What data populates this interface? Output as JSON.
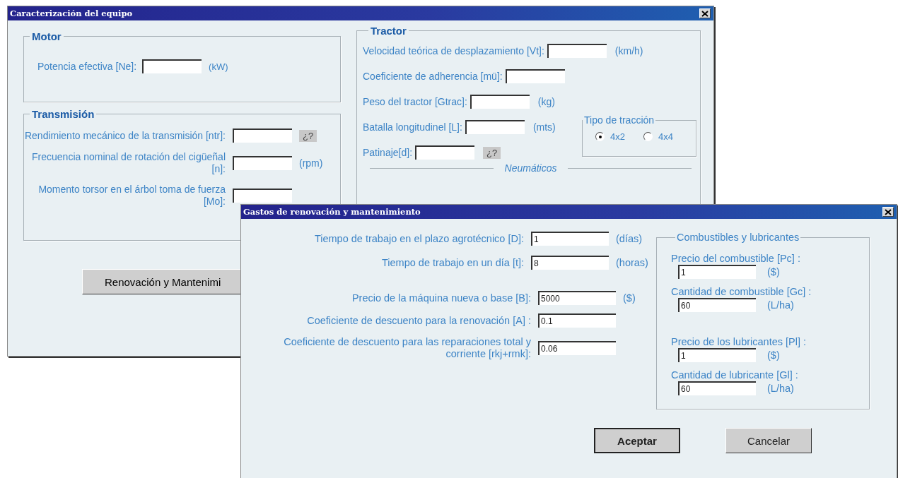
{
  "equipment_window": {
    "title": "Caracterización del equipo",
    "motor_group": {
      "title": "Motor",
      "fields": [
        {
          "label": "Potencia efectiva [Ne]:",
          "unit": "(kW)"
        }
      ]
    },
    "transmission_group": {
      "title": "Transmisión",
      "fields": [
        {
          "label": "Rendimiento mecánico de la transmisión [ntr]:",
          "help_button": "¿?"
        },
        {
          "label": "Frecuencia nominal de rotación del cigüeñal [n]:",
          "unit": "(rpm)"
        },
        {
          "label": "Momento torsor en el árbol toma de fuerza [Mo]:"
        }
      ]
    },
    "tractor_group": {
      "title": "Tractor",
      "fields": [
        {
          "label": "Velocidad teórica de desplazamiento [Vt]:",
          "unit": "(km/h)"
        },
        {
          "label": "Coeficiente de adherencia [mü]:"
        },
        {
          "label": "Peso del tractor [Gtrac]:",
          "unit": "(kg)"
        },
        {
          "label": "Batalla longitudinel [L]:",
          "unit": "(mts)"
        },
        {
          "label": "Patinaje[d]:",
          "help_button": "¿?"
        }
      ],
      "traction_group": {
        "title": "Tipo de tracción",
        "options": [
          {
            "label": "4x2",
            "selected": true
          },
          {
            "label": "4x4",
            "selected": false
          }
        ]
      },
      "tires_heading": "Neumáticos"
    },
    "renewal_button": "Renovación y Mantenimi"
  },
  "costs_window": {
    "title": "Gastos de renovación y mantenimiento",
    "time_fields": [
      {
        "label": "Tiempo de trabajo en el plazo agrotécnico [D]:",
        "value": "1",
        "unit": "(días)"
      },
      {
        "label": "Tiempo de trabajo en un día  [t]:",
        "value": "8",
        "unit": "(horas)"
      }
    ],
    "cost_fields": [
      {
        "label": "Precio de la máquina nueva o base [B]:",
        "value": "5000",
        "unit": "($)"
      },
      {
        "label": "Coeficiente de descuento para la renovación [A] :",
        "value": "0.1"
      },
      {
        "label": "Coeficiente de descuento para las  reparaciones total y corriente [rkj+rmk]:",
        "value": "0.06"
      }
    ],
    "fuel_group": {
      "title": "Combustibles y lubricantes",
      "fields": [
        {
          "label": "Precio del combustible [Pc] :",
          "value": "1",
          "unit": "($)"
        },
        {
          "label": "Cantidad de combustible [Gc] :",
          "value": "60",
          "unit": "(L/ha)"
        },
        {
          "label": "Precio de los lubricantes [Pl] :",
          "value": "1",
          "unit": "($)"
        },
        {
          "label": "Cantidad de lubricante [Gl] :",
          "value": "60",
          "unit": "(L/ha)"
        }
      ]
    },
    "buttons": [
      {
        "label": "Aceptar",
        "default": true
      },
      {
        "label": "Cancelar",
        "default": false
      }
    ]
  }
}
